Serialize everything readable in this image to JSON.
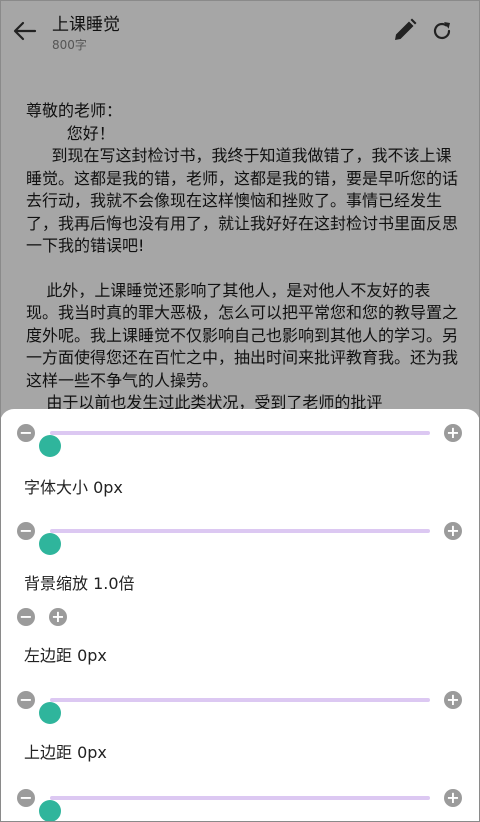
{
  "header": {
    "title": "上课睡觉",
    "word_count": "800字"
  },
  "letter": {
    "paragraphs": [
      "尊敬的老师：",
      "        您好！",
      "     到现在写这封检讨书，我终于知道我做错了，我不该上课睡觉。这都是我的错，老师，这都是我的错，要是早听您的话去行动，我就不会像现在这样懊恼和挫败了。事情已经发生了，我再后悔也没有用了，就让我好好在这封检讨书里面反思一下我的错误吧!",
      "",
      "    此外，上课睡觉还影响了其他人，是对他人不友好的表现。我当时真的罪大恶极，怎么可以把平常您和您的教导置之度外呢。我上课睡觉不仅影响自己也影响到其他人的学习。另一方面使得您还在百忙之中，抽出时间来批评教育我。还为我这样一些不争气的人操劳。",
      "    由于以前也发生过此类状况，受到了老师的批评"
    ]
  },
  "settings": {
    "font_size_label": "字体大小 0px",
    "bg_scale_label": "背景缩放 1.0倍",
    "left_margin_label": "左边距 0px",
    "top_margin_label": "上边距 0px",
    "minus_glyph": "−",
    "plus_glyph": "+",
    "sliders": {
      "top": 0,
      "font_size": 0,
      "left_margin": 0,
      "top_margin": 0
    }
  },
  "colors": {
    "overlay_bg": "#a6a6a6",
    "accent_thumb": "#2fb59c",
    "track": "#dcc8f2",
    "button_gray": "#9b9b9b"
  },
  "icons": {
    "back": "arrow-left",
    "edit": "pencil",
    "refresh": "refresh"
  }
}
